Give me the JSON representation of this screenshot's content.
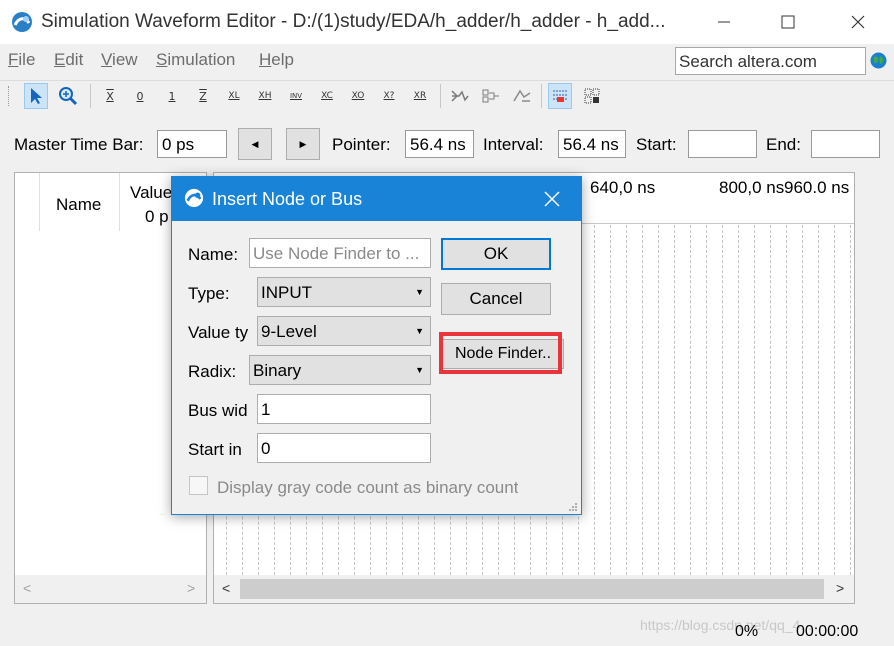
{
  "window": {
    "title": "Simulation Waveform Editor - D:/(1)study/EDA/h_adder/h_adder - h_add..."
  },
  "menu": {
    "items": [
      {
        "label": "File",
        "mnemonic": "F",
        "rest": "ile"
      },
      {
        "label": "Edit",
        "mnemonic": "E",
        "rest": "dit"
      },
      {
        "label": "View",
        "mnemonic": "V",
        "rest": "iew"
      },
      {
        "label": "Simulation",
        "mnemonic": "S",
        "rest": "imulation"
      },
      {
        "label": "Help",
        "mnemonic": "H",
        "rest": "elp"
      }
    ],
    "search_value": "Search altera.com"
  },
  "toolbar": {
    "icons": [
      "selection-tool-icon",
      "zoom-tool-icon",
      "forcing-unknown-icon",
      "forcing-low-icon",
      "forcing-high-icon",
      "high-impedance-icon",
      "weak-low-icon",
      "weak-high-icon",
      "invert-icon",
      "count-value-icon",
      "clock-icon",
      "arbitrary-value-icon",
      "random-value-icon",
      "snap-to-grid-icon",
      "grid-icon"
    ],
    "glyph_labels": {
      "x": "X",
      "zero": "0",
      "one": "1",
      "z": "Z",
      "xl": "XL",
      "xh": "XH",
      "inv": "INV",
      "xc": "XC",
      "xo": "XO",
      "x2": "X?",
      "xr": "XR"
    }
  },
  "timebar": {
    "master_label": "Master Time Bar:",
    "master_value": "0 ps",
    "pointer_label": "Pointer:",
    "pointer_value": "56.4 ns",
    "interval_label": "Interval:",
    "interval_value": "56.4 ns",
    "start_label": "Start:",
    "start_value": "",
    "end_label": "End:",
    "end_value": ""
  },
  "node_list": {
    "name_header": "Name",
    "value_header": "Value",
    "value_sub": "0 p"
  },
  "waveform": {
    "time_labels": [
      "640,0 ns",
      "800,0 ns",
      "960.0 ns"
    ]
  },
  "dialog": {
    "title": "Insert Node or Bus",
    "name_label": "Name:",
    "name_placeholder": "Use Node Finder to ...",
    "type_label": "Type:",
    "type_value": "INPUT",
    "value_type_label": "Value ty",
    "value_type_value": "9-Level",
    "radix_label": "Radix:",
    "radix_value": "Binary",
    "bus_width_label": "Bus wid",
    "bus_width_value": "1",
    "start_index_label": "Start in",
    "start_index_value": "0",
    "gray_code_label": "Display gray code count as binary count",
    "gray_code_checked": false,
    "ok_label": "OK",
    "cancel_label": "Cancel",
    "node_finder_label": "Node Finder..",
    "highlight_color": "#e8343a"
  },
  "status": {
    "progress": "0%",
    "elapsed": "00:00:00",
    "watermark": "https://blog.csdn.net/qq_4..."
  },
  "colors": {
    "accent": "#1883d7",
    "highlight": "#e8343a"
  }
}
